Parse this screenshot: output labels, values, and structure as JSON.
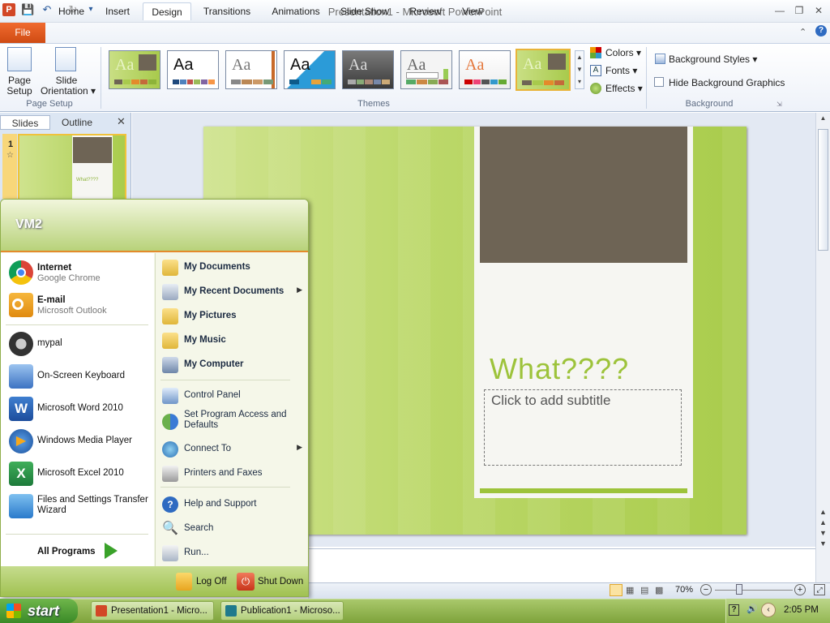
{
  "window": {
    "title": "Presentation1  -  Microsoft PowerPoint"
  },
  "tabs": [
    "File",
    "Home",
    "Insert",
    "Design",
    "Transitions",
    "Animations",
    "Slide Show",
    "Review",
    "View"
  ],
  "ribbon": {
    "page_setup": {
      "btn1": "Page\nSetup",
      "btn2a": "Slide",
      "btn2b": "Orientation",
      "group": "Page Setup"
    },
    "themes": {
      "group": "Themes",
      "aa": "Aa",
      "colors": "Colors",
      "fonts": "Fonts",
      "effects": "Effects"
    },
    "background": {
      "styles": "Background Styles",
      "hide": "Hide Background Graphics",
      "group": "Background"
    }
  },
  "pane": {
    "tab_slides": "Slides",
    "tab_outline": "Outline",
    "slide_number": "1",
    "thumb_text": "What????"
  },
  "slide": {
    "title": "What????",
    "subtitle_placeholder": "Click to add subtitle"
  },
  "status": {
    "zoom": "70%"
  },
  "start_menu": {
    "user": "VM2",
    "pinned": [
      {
        "name": "Internet",
        "sub": "Google Chrome",
        "icon": "chrome-icon"
      },
      {
        "name": "E-mail",
        "sub": "Microsoft Outlook",
        "icon": "outlook-icon"
      }
    ],
    "recent": [
      "mypal",
      "On-Screen Keyboard",
      "Microsoft Word 2010",
      "Windows Media Player",
      "Microsoft Excel 2010",
      "Files and Settings Transfer Wizard"
    ],
    "all_programs": "All Programs",
    "right": [
      "My Documents",
      "My Recent Documents",
      "My Pictures",
      "My Music",
      "My Computer",
      "Control Panel",
      "Set Program Access and Defaults",
      "Connect To",
      "Printers and Faxes",
      "Help and Support",
      "Search",
      "Run..."
    ],
    "log_off": "Log Off",
    "shut_down": "Shut Down"
  },
  "taskbar": {
    "start": "start",
    "items": [
      "Presentation1 - Micro...",
      "Publication1 - Microso..."
    ],
    "clock": "2:05 PM"
  },
  "colors": {
    "accent_green": "#9dc33b",
    "slide_dark": "#6e6455",
    "file_tab": "#e35e1d"
  }
}
